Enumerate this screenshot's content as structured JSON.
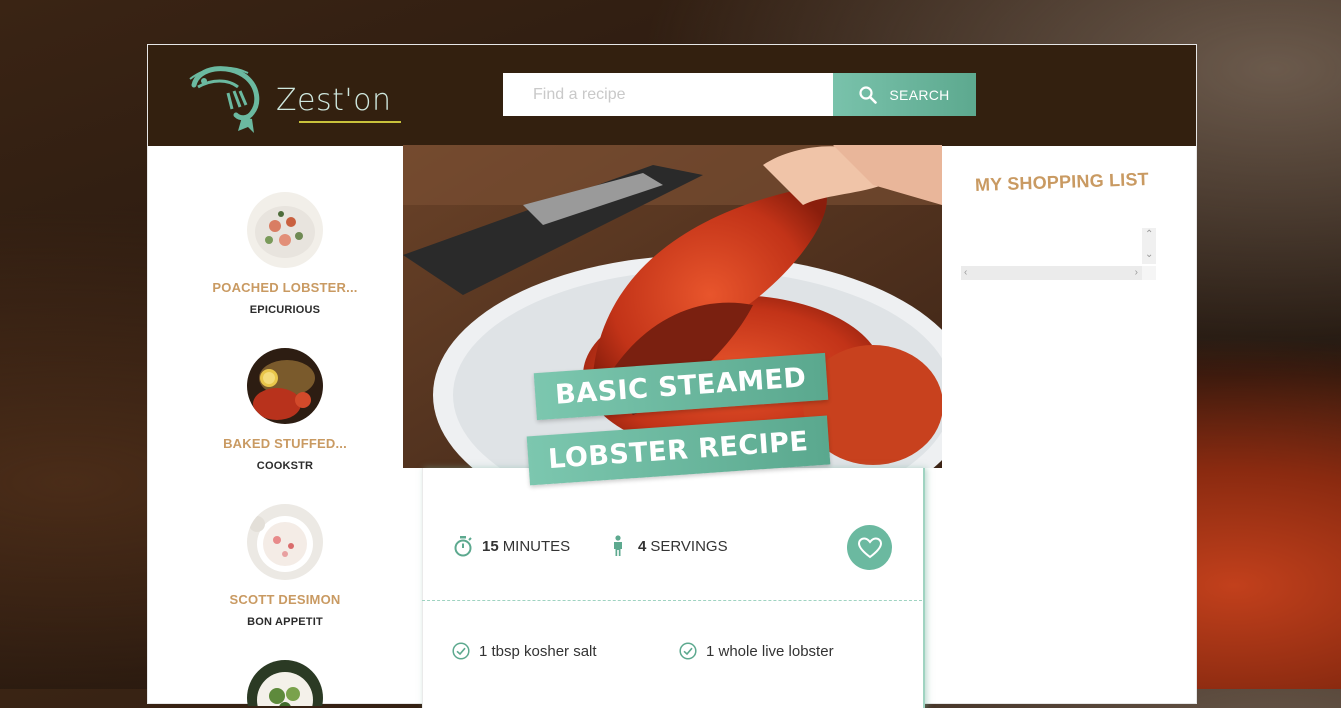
{
  "header": {
    "brand": "Zest'on",
    "search_placeholder": "Find a recipe",
    "search_button": "SEARCH"
  },
  "sidebar": {
    "items": [
      {
        "title": "POACHED LOBSTER...",
        "source": "EPICURIOUS"
      },
      {
        "title": "BAKED STUFFED...",
        "source": "COOKSTR"
      },
      {
        "title": "SCOTT DESIMON",
        "source": "BON APPETIT"
      }
    ]
  },
  "recipe": {
    "title_line1": "BASIC STEAMED",
    "title_line2": "LOBSTER RECIPE",
    "minutes_value": "15",
    "minutes_label": "MINUTES",
    "servings_value": "4",
    "servings_label": "SERVINGS",
    "ingredients": [
      "1 tbsp kosher salt",
      "1 whole live lobster"
    ]
  },
  "shopping_list": {
    "title": "MY SHOPPING LIST"
  },
  "colors": {
    "header_bg": "#33200f",
    "accent": "#6bb9a0",
    "title_gold": "#c99a62"
  }
}
